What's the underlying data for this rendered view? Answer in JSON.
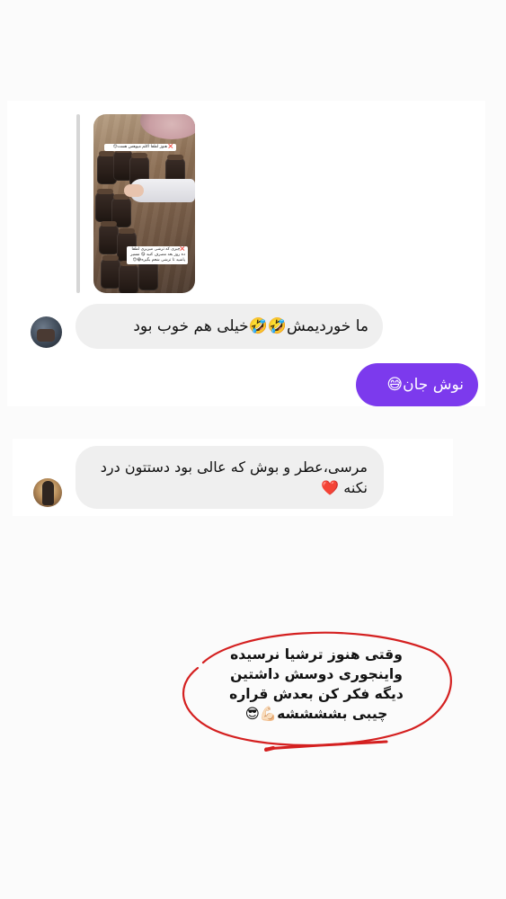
{
  "story_reply": {
    "sticker_top": "❌ هنوز لطفا اکلم میوهس هست😊",
    "sticker_bottom": "❌چیزی که ترشی میریزی لطفا ده روز بعد مصرف کنید 😋 مسیر پاشید تا ترشی شعم بگیره😂😊"
  },
  "messages": [
    {
      "direction": "incoming",
      "text": "ما خوردیمش🤣🤣خیلی هم خوب بود"
    },
    {
      "direction": "outgoing",
      "text": "نوش جان😅"
    },
    {
      "direction": "incoming",
      "text": "مرسی،عطر و بوش که عالی بود دستتون درد نکنه ❤️"
    }
  ],
  "annotation": {
    "lines": [
      "وقتی هنوز ترشیا نرسیده",
      "واینجوری دوسش داشتین",
      "دیگه فکر کن بعدش قراره",
      "چیبی بششششه💪🏻😎"
    ],
    "circle_color": "#d42020"
  },
  "colors": {
    "outgoing_bubble": "#7c3aed",
    "incoming_bubble": "#efefef"
  }
}
